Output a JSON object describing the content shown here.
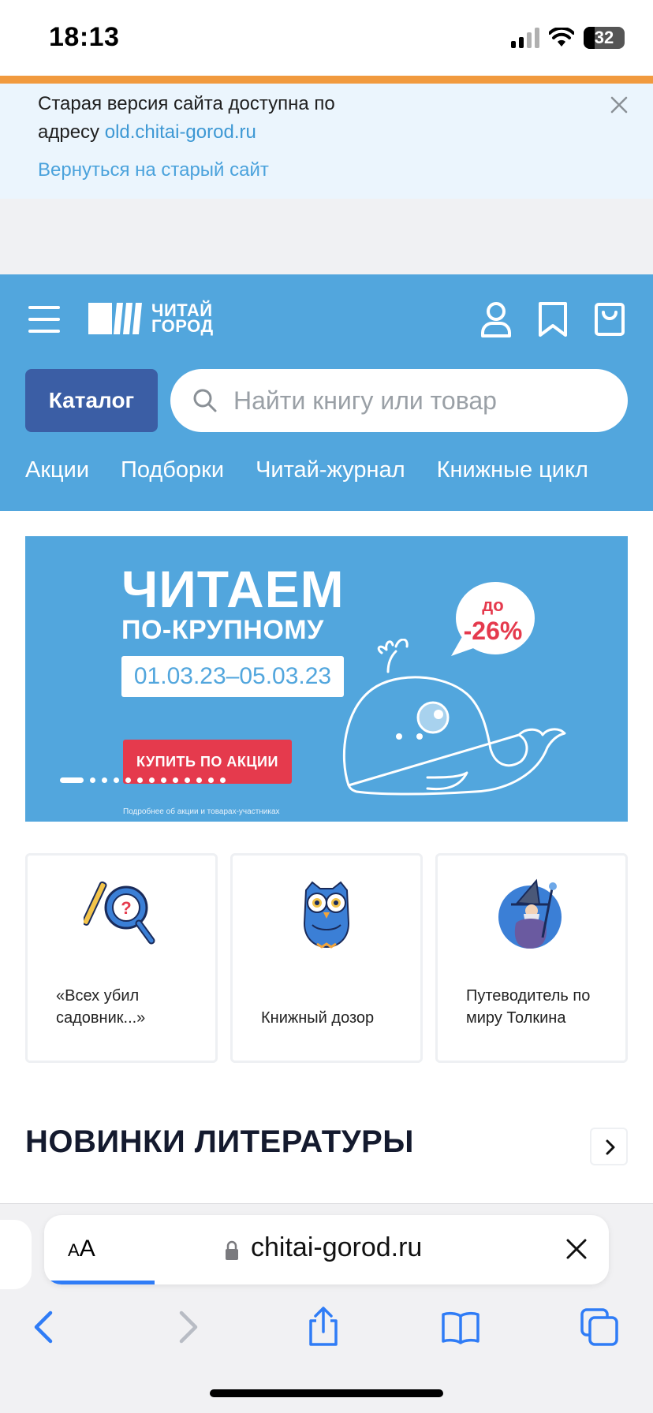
{
  "status_bar": {
    "time": "18:13",
    "battery": "32",
    "icons": [
      "cellular-signal-icon",
      "wifi-icon",
      "battery-icon"
    ]
  },
  "notice": {
    "text_prefix": "Старая версия сайта доступна по адресу",
    "link": "old.chitai-gorod.ru",
    "return_link": "Вернуться на старый сайт",
    "close_icon": "close-icon"
  },
  "header": {
    "logo_line1": "ЧИТАЙ",
    "logo_line2": "ГОРОД",
    "catalog_button": "Каталог",
    "search_placeholder": "Найти книгу или товар",
    "icons": [
      "menu-icon",
      "user-icon",
      "bookmark-icon",
      "cart-icon",
      "search-icon"
    ],
    "nav": [
      "Акции",
      "Подборки",
      "Читай-журнал",
      "Книжные цикл"
    ]
  },
  "promo": {
    "title": "ЧИТАЕМ",
    "subtitle": "ПО-КРУПНОМУ",
    "dates": "01.03.23–05.03.23",
    "discount_prefix": "до",
    "discount": "-26%",
    "button": "КУПИТЬ ПО АКЦИИ",
    "footnote": "Подробнее об акции и товарах-участниках",
    "slides_total": 13,
    "active_slide": 1
  },
  "cards": [
    {
      "label": "«Всех убил садовник...»",
      "icon": "magnifier-question-icon"
    },
    {
      "label": "Книжный дозор",
      "icon": "owl-icon"
    },
    {
      "label": "Путеводитель по миру Толкина",
      "icon": "wizard-icon"
    }
  ],
  "section": {
    "title": "НОВИНКИ ЛИТЕРАТУРЫ",
    "arrow_icon": "chevron-right-icon"
  },
  "safari": {
    "aa": "AA",
    "url": "chitai-gorod.ru",
    "toolbar": [
      "back-icon",
      "forward-icon",
      "share-icon",
      "bookmarks-icon",
      "tabs-icon"
    ]
  },
  "colors": {
    "brand_blue": "#52a6dd",
    "catalog_blue": "#3b5ea5",
    "accent_orange": "#f19a3e",
    "promo_red": "#e53a4d"
  }
}
